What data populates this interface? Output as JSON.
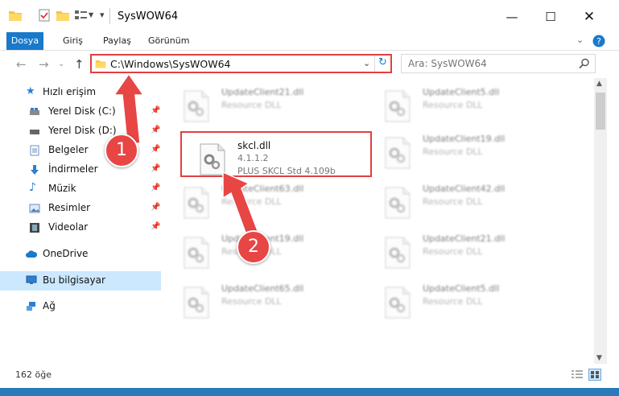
{
  "window": {
    "title": "SysWOW64"
  },
  "ribbon": {
    "tabs": [
      "Dosya",
      "Giriş",
      "Paylaş",
      "Görünüm"
    ]
  },
  "nav": {
    "address": "C:\\Windows\\SysWOW64",
    "search_placeholder": "Ara: SysWOW64"
  },
  "sidebar": {
    "quick_access": "Hızlı erişim",
    "items": [
      "Yerel Disk (C:)",
      "Yerel Disk (D:)",
      "Belgeler",
      "İndirmeler",
      "Müzik",
      "Resimler",
      "Videolar"
    ],
    "onedrive": "OneDrive",
    "this_pc": "Bu bilgisayar",
    "network": "Ağ"
  },
  "files": [
    {
      "name": "UpdateClient21.dll",
      "desc": "Resource DLL"
    },
    {
      "name": "UpdateClient5.dll",
      "desc": "Resource DLL"
    },
    {
      "name": "skcl.dll",
      "version": "4.1.1.2",
      "desc": "PLUS SKCL Std 4.109b"
    },
    {
      "name": "UpdateClient19.dll",
      "desc": "Resource DLL"
    },
    {
      "name": "UpdateClient63.dll",
      "desc": "Resource DLL"
    },
    {
      "name": "UpdateClient42.dll",
      "desc": "Resource DLL"
    },
    {
      "name": "UpdateClient19.dll",
      "desc": "Resource DLL"
    },
    {
      "name": "UpdateClient21.dll",
      "desc": "Resource DLL"
    },
    {
      "name": "UpdateClient65.dll",
      "desc": "Resource DLL"
    },
    {
      "name": "UpdateClient5.dll",
      "desc": "Resource DLL"
    }
  ],
  "status": {
    "count": "162 öğe"
  },
  "callouts": [
    "1",
    "2"
  ],
  "colors": {
    "accent": "#1979ca",
    "highlight": "#e04040",
    "selected": "#cce8ff"
  }
}
